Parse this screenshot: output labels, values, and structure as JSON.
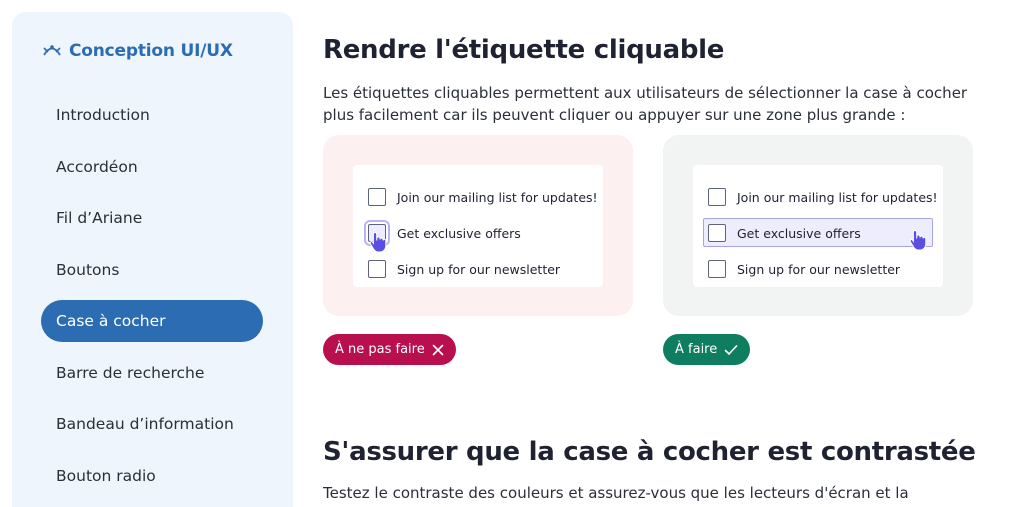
{
  "sidebar": {
    "brand": "Conception UI/UX",
    "items": [
      {
        "label": "Introduction"
      },
      {
        "label": "Accordéon"
      },
      {
        "label": "Fil d’Ariane"
      },
      {
        "label": "Boutons"
      },
      {
        "label": "Case à cocher",
        "active": true
      },
      {
        "label": "Barre de recherche"
      },
      {
        "label": "Bandeau d’information"
      },
      {
        "label": "Bouton radio"
      }
    ]
  },
  "main": {
    "title": "Rendre l'étiquette cliquable",
    "description": "Les étiquettes cliquables permettent aux utilisateurs de sélectionner la case à cocher plus facilement car ils peuvent cliquer ou appuyer sur une zone plus grande :",
    "example_bad": {
      "options": [
        "Join our mailing list for updates!",
        "Get exclusive offers",
        "Sign up for our newsletter"
      ],
      "badge": "À ne pas faire"
    },
    "example_good": {
      "options": [
        "Join our mailing list for updates!",
        "Get exclusive offers",
        "Sign up for our newsletter"
      ],
      "badge": "À faire"
    },
    "section2_title": "S'assurer que la case à cocher est contrastée",
    "section2_text": "Testez le contraste des couleurs et assurez-vous que les lecteurs d'écran et la"
  },
  "colors": {
    "accent": "#2c6cb2",
    "bad": "#b8104f",
    "good": "#0f7d5f",
    "cursor": "#5a4fe0"
  }
}
